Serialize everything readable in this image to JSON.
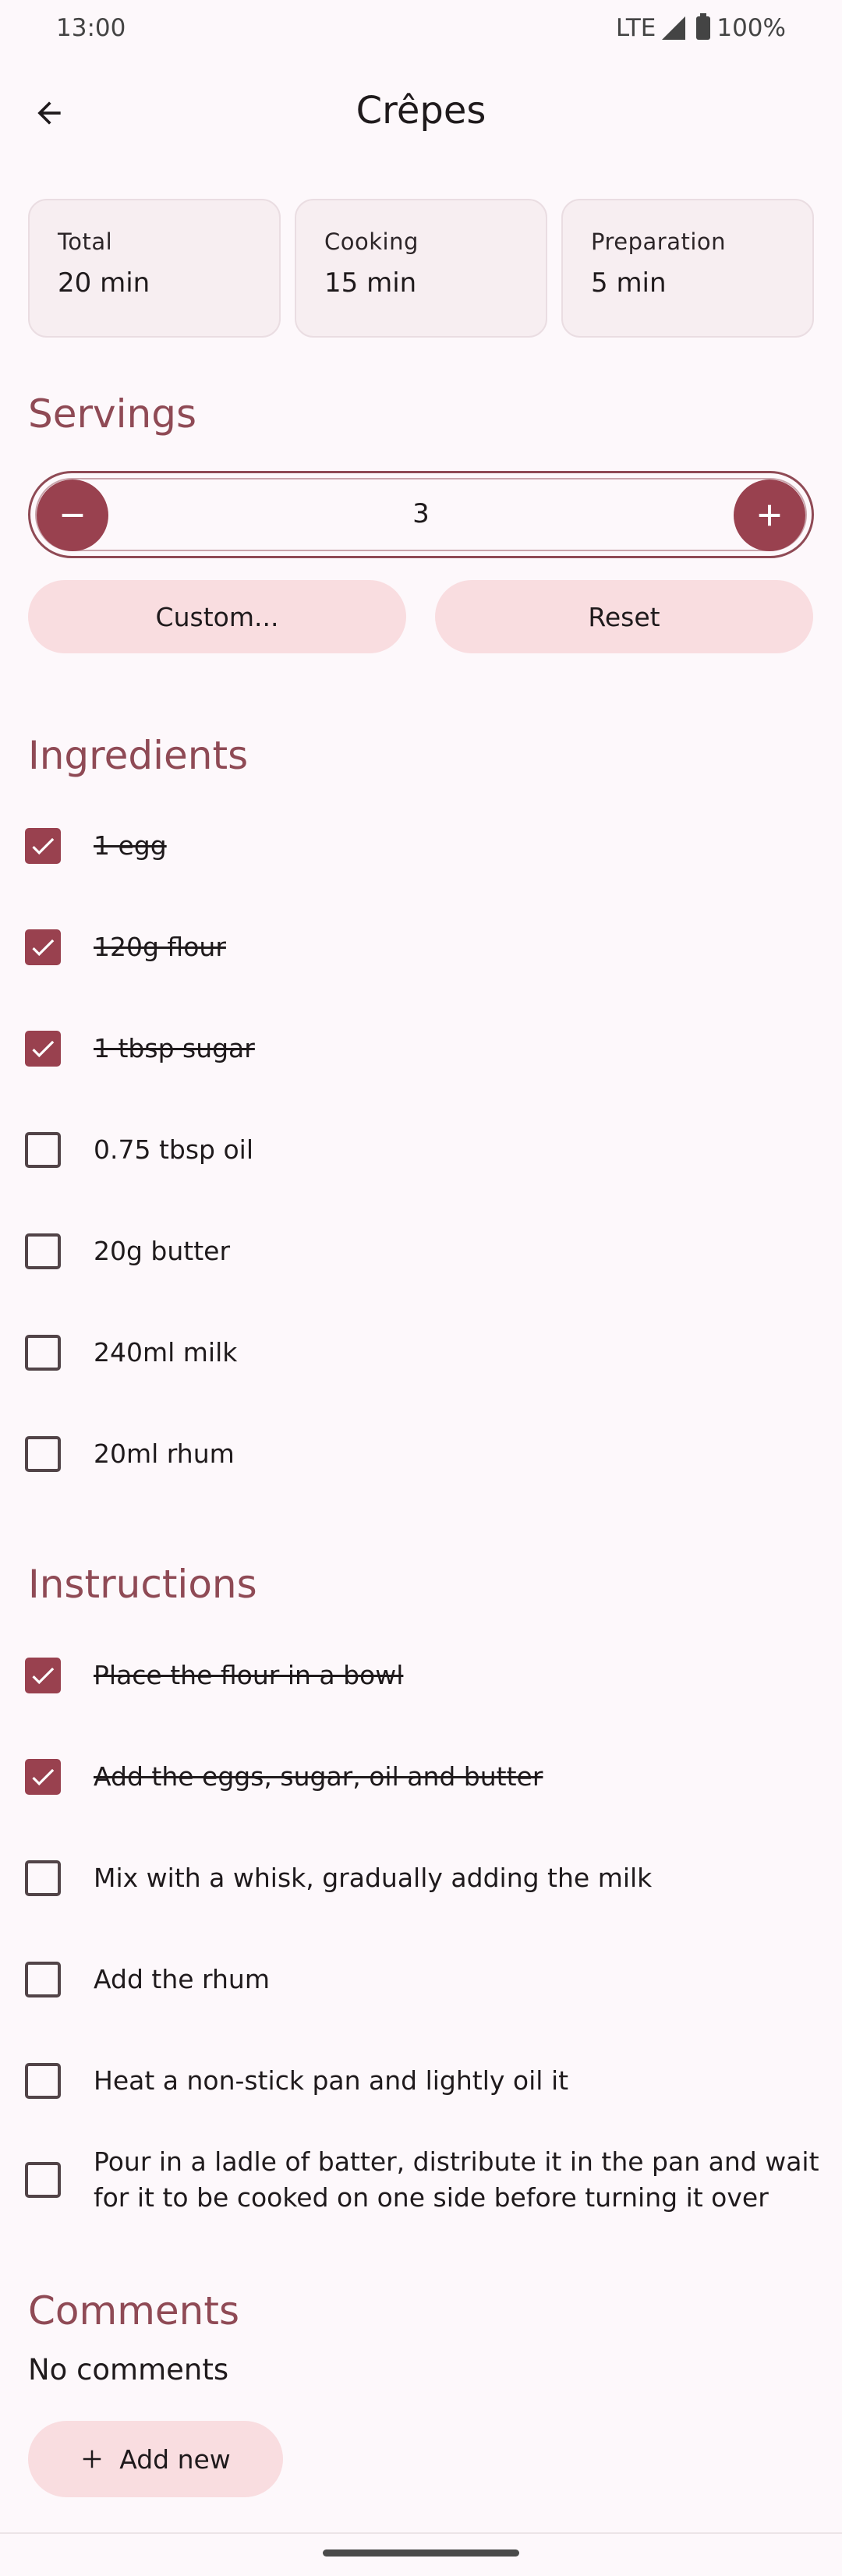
{
  "status_bar": {
    "time": "13:00",
    "network": "LTE",
    "battery": "100%"
  },
  "header": {
    "title": "Crêpes",
    "back_icon": "arrow-back-icon"
  },
  "times": [
    {
      "label": "Total",
      "value": "20 min"
    },
    {
      "label": "Cooking",
      "value": "15 min"
    },
    {
      "label": "Preparation",
      "value": "5 min"
    }
  ],
  "servings": {
    "title": "Servings",
    "value": "3",
    "custom_label": "Custom...",
    "reset_label": "Reset"
  },
  "ingredients": {
    "title": "Ingredients",
    "items": [
      {
        "label": "1 egg",
        "checked": true
      },
      {
        "label": "120g flour",
        "checked": true
      },
      {
        "label": "1 tbsp sugar",
        "checked": true
      },
      {
        "label": "0.75 tbsp oil",
        "checked": false
      },
      {
        "label": "20g butter",
        "checked": false
      },
      {
        "label": "240ml milk",
        "checked": false
      },
      {
        "label": "20ml rhum",
        "checked": false
      }
    ]
  },
  "instructions": {
    "title": "Instructions",
    "items": [
      {
        "label": "Place the flour in a bowl",
        "checked": true
      },
      {
        "label": "Add the eggs, sugar, oil and butter",
        "checked": true
      },
      {
        "label": "Mix with a whisk, gradually adding the milk",
        "checked": false
      },
      {
        "label": "Add the rhum",
        "checked": false
      },
      {
        "label": "Heat a non-stick pan and lightly oil it",
        "checked": false
      },
      {
        "label": "Pour in a ladle of batter, distribute it in the pan and wait for it to be cooked on one side before turning it over",
        "checked": false
      }
    ]
  },
  "comments": {
    "title": "Comments",
    "empty_text": "No comments",
    "add_label": "Add new"
  },
  "colors": {
    "accent": "#99414f",
    "section_title": "#8f4a55",
    "tonal_button": "#f9dde0",
    "background": "#fdf8fb"
  }
}
